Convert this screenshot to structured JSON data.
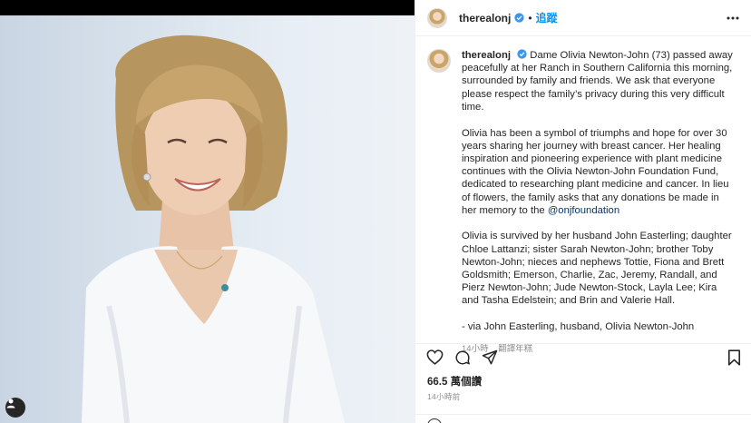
{
  "post": {
    "username": "therealonj",
    "follow_label": "追蹤",
    "caption": {
      "p1": "Dame Olivia Newton-John (73) passed away peacefully at her Ranch in Southern California this morning, surrounded by family and friends. We ask that everyone please respect the family’s privacy during this very difficult time.",
      "p2": "Olivia has been a symbol of triumphs and hope for over 30 years sharing her journey with breast cancer. Her healing inspiration and pioneering experience with plant medicine continues with the Olivia Newton-John Foundation Fund, dedicated to researching plant medicine and cancer. In lieu of flowers, the family asks that any donations be made in her memory to the",
      "mention": "@onjfoundation",
      "p3": "Olivia is survived by her husband John Easterling; daughter Chloe Lattanzi; sister Sarah Newton-John; brother Toby Newton-John; nieces and nephews Tottie, Fiona and Brett Goldsmith; Emerson, Charlie, Zac, Jeremy, Randall, and Pierz Newton-John; Jude Newton-Stock, Layla Lee; Kira and Tasha Edelstein; and Brin and Valerie Hall.",
      "p4": "- via John Easterling, husband, Olivia Newton-John"
    },
    "caption_age": "14小時",
    "translate_label": "翻譯年糕",
    "views": "66.5 萬個讚",
    "posted_time": "14小時前"
  },
  "icons": {
    "like": "heart-icon",
    "comment": "comment-icon",
    "share": "share-icon",
    "save": "bookmark-icon",
    "more": "more-icon",
    "verified": "verified-icon",
    "tagged": "user-tag-icon"
  },
  "colors": {
    "accent": "#0095f6",
    "verified": "#3897f0",
    "text": "#262626",
    "muted": "#8e8e8e",
    "mention": "#00376b"
  }
}
